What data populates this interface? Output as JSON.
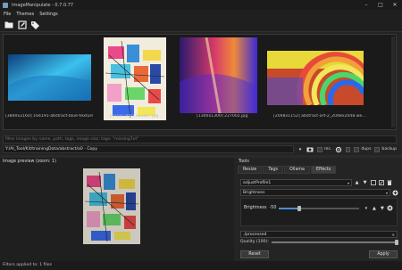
{
  "window": {
    "title": "ImageManipulate - 0.7.0.77",
    "minimize": "–",
    "maximize": "□",
    "close": "✕"
  },
  "menu": [
    "File",
    "Themes",
    "Settings"
  ],
  "toolbar": {
    "icons": [
      "open-folder-icon",
      "edit-icon",
      "tags-icon"
    ]
  },
  "gallery": {
    "thumbnails": [
      {
        "caption": "[3840x2160] 164191-abstract-blue-texture...",
        "colors": [
          "#1a4a8c",
          "#3fb8e8",
          "#0d6aa6"
        ]
      },
      {
        "caption": "[975x1300] 183347.jpg",
        "colors": [
          "#e84a8a",
          "#4aa8e8",
          "#f2e65a"
        ]
      },
      {
        "caption": "[1300x1300] 227002.jpg",
        "colors": [
          "#2a1a6c",
          "#e83a6a",
          "#4a2ad6"
        ]
      },
      {
        "caption": "[2048x1152] abstract-art-2_2048x2048.we...",
        "colors": [
          "#e8d83a",
          "#e84a3a",
          "#2a6ae8"
        ]
      }
    ]
  },
  "filter": {
    "placeholder": "filter images by name, path, tags, image size, tags: \"missingTxt\""
  },
  "path": {
    "value": "Y:/AI_Tool/Kit/trainingData/abstract/a0 - Copy",
    "rec_label": "rec.",
    "dups_label": "dups",
    "backup_label": "backup"
  },
  "preview": {
    "title": "Image preview (zoom: 1)"
  },
  "status": {
    "text": "Filters applied to: 1 files"
  },
  "tools": {
    "title": "Tools",
    "tabs": [
      "Resize",
      "Tags",
      "Ollama",
      "Effects"
    ],
    "active_tab": "Effects",
    "profile_value": "adjustProfile1",
    "effect_value": "Brightness",
    "brightness": {
      "label": "Brightness",
      "value": "-50",
      "slider_fraction": 0.25
    },
    "output_path": "./processed",
    "quality_label": "Quality (100):",
    "quality_fraction": 1.0,
    "reset_label": "Reset",
    "apply_label": "Apply"
  }
}
